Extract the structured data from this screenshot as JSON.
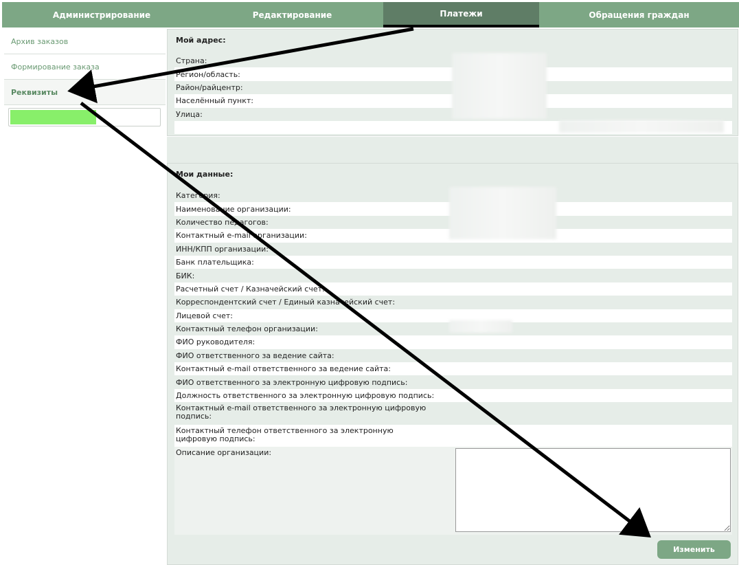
{
  "nav": {
    "tabs": [
      {
        "label": "Администрирование"
      },
      {
        "label": "Редактирование"
      },
      {
        "label": "Платежи"
      },
      {
        "label": "Обращения граждан"
      }
    ],
    "active": "Платежи"
  },
  "sidebar": {
    "items": [
      {
        "label": "Архив заказов"
      },
      {
        "label": "Формирование заказа"
      },
      {
        "label": "Реквизиты"
      }
    ],
    "active": "Реквизиты",
    "progress_fraction": 0.58
  },
  "address": {
    "title": "Мой адрес:",
    "fields": [
      {
        "label": "Страна:"
      },
      {
        "label": "Регион/область:"
      },
      {
        "label": "Район/райцентр:"
      },
      {
        "label": "Населённый пункт:"
      },
      {
        "label": "Улица:"
      }
    ]
  },
  "mydata": {
    "title": "Мои данные:",
    "fields": [
      {
        "label": "Категория:"
      },
      {
        "label": "Наименование организации:"
      },
      {
        "label": "Количество педагогов:"
      },
      {
        "label": "Контактный e-mail организации:"
      },
      {
        "label": "ИНН/КПП организации:"
      },
      {
        "label": "Банк плательщика:"
      },
      {
        "label": "БИК:"
      },
      {
        "label": "Расчетный счет / Казначейский счет:"
      },
      {
        "label": "Корреспондентский счет / Единый казначейский счет:"
      },
      {
        "label": "Лицевой счет:"
      },
      {
        "label": "Контактный телефон организации:"
      },
      {
        "label": "ФИО руководителя:"
      },
      {
        "label": "ФИО ответственного за ведение сайта:"
      },
      {
        "label": "Контактный e-mail ответственного за ведение сайта:"
      },
      {
        "label": "ФИО ответственного за электронную цифровую подпись:"
      },
      {
        "label": "Должность ответственного за электронную цифровую подпись:"
      },
      {
        "label": "Контактный e-mail ответственного за электронную цифровую подпись:"
      },
      {
        "label": "Контактный телефон ответственного за электронную цифровую подпись:"
      }
    ],
    "description_label": "Описание организации:",
    "description_value": "",
    "submit_label": "Изменить"
  },
  "colors": {
    "nav_bg": "#7da785",
    "nav_active": "#5f7d66",
    "panel_bg": "#e6ede8",
    "progress_fill": "#88ef6a",
    "link": "#6a9a73"
  }
}
